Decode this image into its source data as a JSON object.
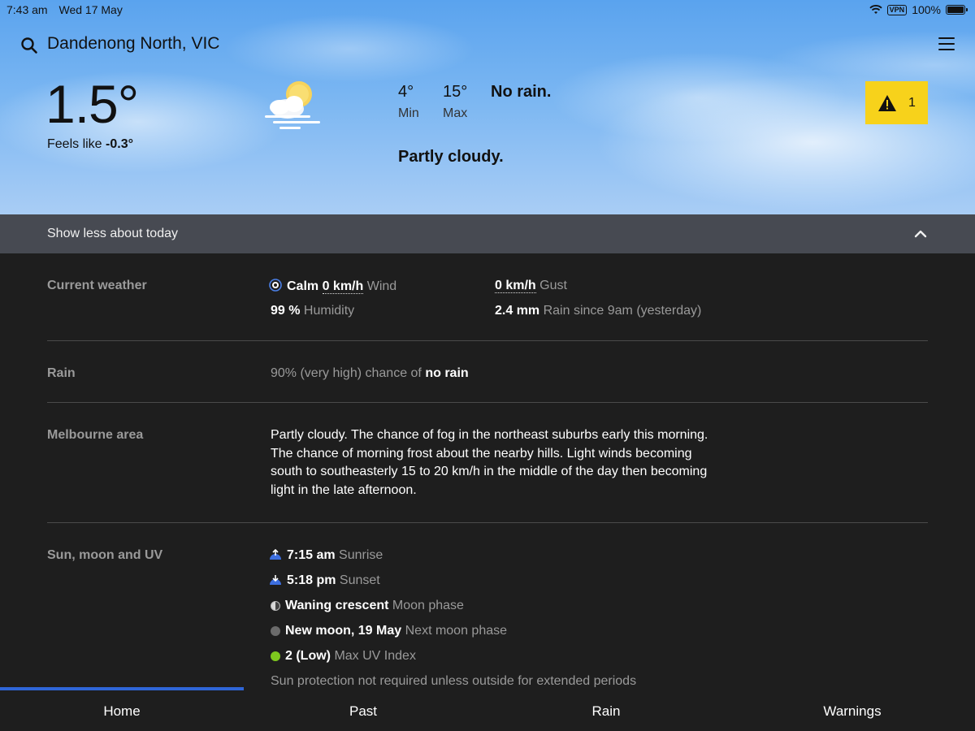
{
  "status_bar": {
    "time": "7:43 am",
    "date": "Wed 17 May",
    "vpn": "VPN",
    "battery": "100%"
  },
  "header": {
    "location": "Dandenong North, VIC"
  },
  "current": {
    "temperature": "1.5°",
    "feels_like_label": "Feels like",
    "feels_like_value": "-0.3°",
    "icon": "partly-cloudy-icon",
    "min_value": "4°",
    "min_label": "Min",
    "max_value": "15°",
    "max_label": "Max",
    "rain_summary": "No rain.",
    "description": "Partly cloudy.",
    "warnings_count": "1"
  },
  "toggle": {
    "label": "Show less about today"
  },
  "details": {
    "current_weather": {
      "label": "Current weather",
      "wind_state": "Calm",
      "wind_speed": "0 km/h",
      "wind_label": "Wind",
      "gust_speed": "0 km/h",
      "gust_label": "Gust",
      "humidity_value": "99 %",
      "humidity_label": "Humidity",
      "rain_value": "2.4 mm",
      "rain_label": "Rain since 9am (yesterday)"
    },
    "rain": {
      "label": "Rain",
      "chance_text": "90% (very high) chance of",
      "amount": "no rain"
    },
    "area": {
      "label": "Melbourne area",
      "forecast": "Partly cloudy. The chance of fog in the northeast suburbs early this morning. The chance of morning frost about the nearby hills. Light winds becoming south to southeasterly 15 to 20 km/h in the middle of the day then becoming light in the late afternoon."
    },
    "sun_moon_uv": {
      "label": "Sun, moon and UV",
      "sunrise_time": "7:15 am",
      "sunrise_label": "Sunrise",
      "sunset_time": "5:18 pm",
      "sunset_label": "Sunset",
      "moon_phase": "Waning crescent",
      "moon_phase_label": "Moon phase",
      "next_moon": "New moon, 19 May",
      "next_moon_label": "Next moon phase",
      "uv_value": "2 (Low)",
      "uv_label": "Max UV Index",
      "uv_note": "Sun protection not required unless outside for extended periods"
    }
  },
  "nav": {
    "home": "Home",
    "past": "Past",
    "rain": "Rain",
    "warnings": "Warnings"
  },
  "colors": {
    "accent": "#2f66d8",
    "warning": "#f7d21b",
    "uv_low": "#7ec81e",
    "panel": "#1e1e1e",
    "toggle_bg": "#474a52"
  }
}
